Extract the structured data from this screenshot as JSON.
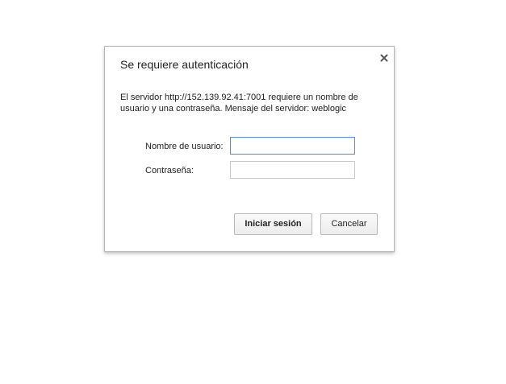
{
  "dialog": {
    "title": "Se requiere autenticación",
    "close_icon": "close-icon",
    "message": "El servidor http://152.139.92.41:7001 requiere un nombre de usuario y una contraseña. Mensaje del servidor: weblogic",
    "username_label": "Nombre de usuario:",
    "username_value": "",
    "password_label": "Contraseña:",
    "password_value": "",
    "login_button": "Iniciar sesión",
    "cancel_button": "Cancelar"
  },
  "colors": {
    "focus_border": "#5b8fd6",
    "dialog_border": "#b8b8b8"
  }
}
